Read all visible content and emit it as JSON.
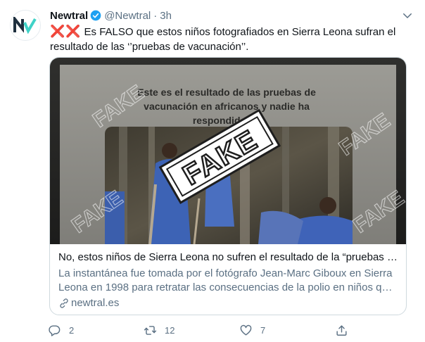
{
  "tweet": {
    "author_name": "Newtral",
    "handle": "@Newtral",
    "separator": "·",
    "time": "3h",
    "marks": "❌❌",
    "text": "Es FALSO que estos niños fotografiados en Sierra Leona sufran el resultado de las ‘’pruebas de vacunación’’."
  },
  "card": {
    "image_caption": "Este es el resultado de las pruebas de vacunación en africanos y nadie ha respondido n...",
    "stamp": "FAKE",
    "watermark": "FAKE",
    "title": "No, estos niños de Sierra Leona no sufren el resultado de la “pruebas de vacunación”",
    "description": "La instantánea fue tomada por el fotógrafo Jean-Marc Giboux en Sierra Leona en 1998 para retratar las consecuencias de la polio en niños que todavía hoy...",
    "domain": "newtral.es"
  },
  "actions": {
    "replies": "2",
    "retweets": "12",
    "likes": "7"
  },
  "colors": {
    "verified": "#1da1f2",
    "marks": "#e0245e",
    "secondary_text": "#5b7083",
    "logo_dark": "#1e2f3e",
    "logo_green": "#3fd2c7"
  }
}
